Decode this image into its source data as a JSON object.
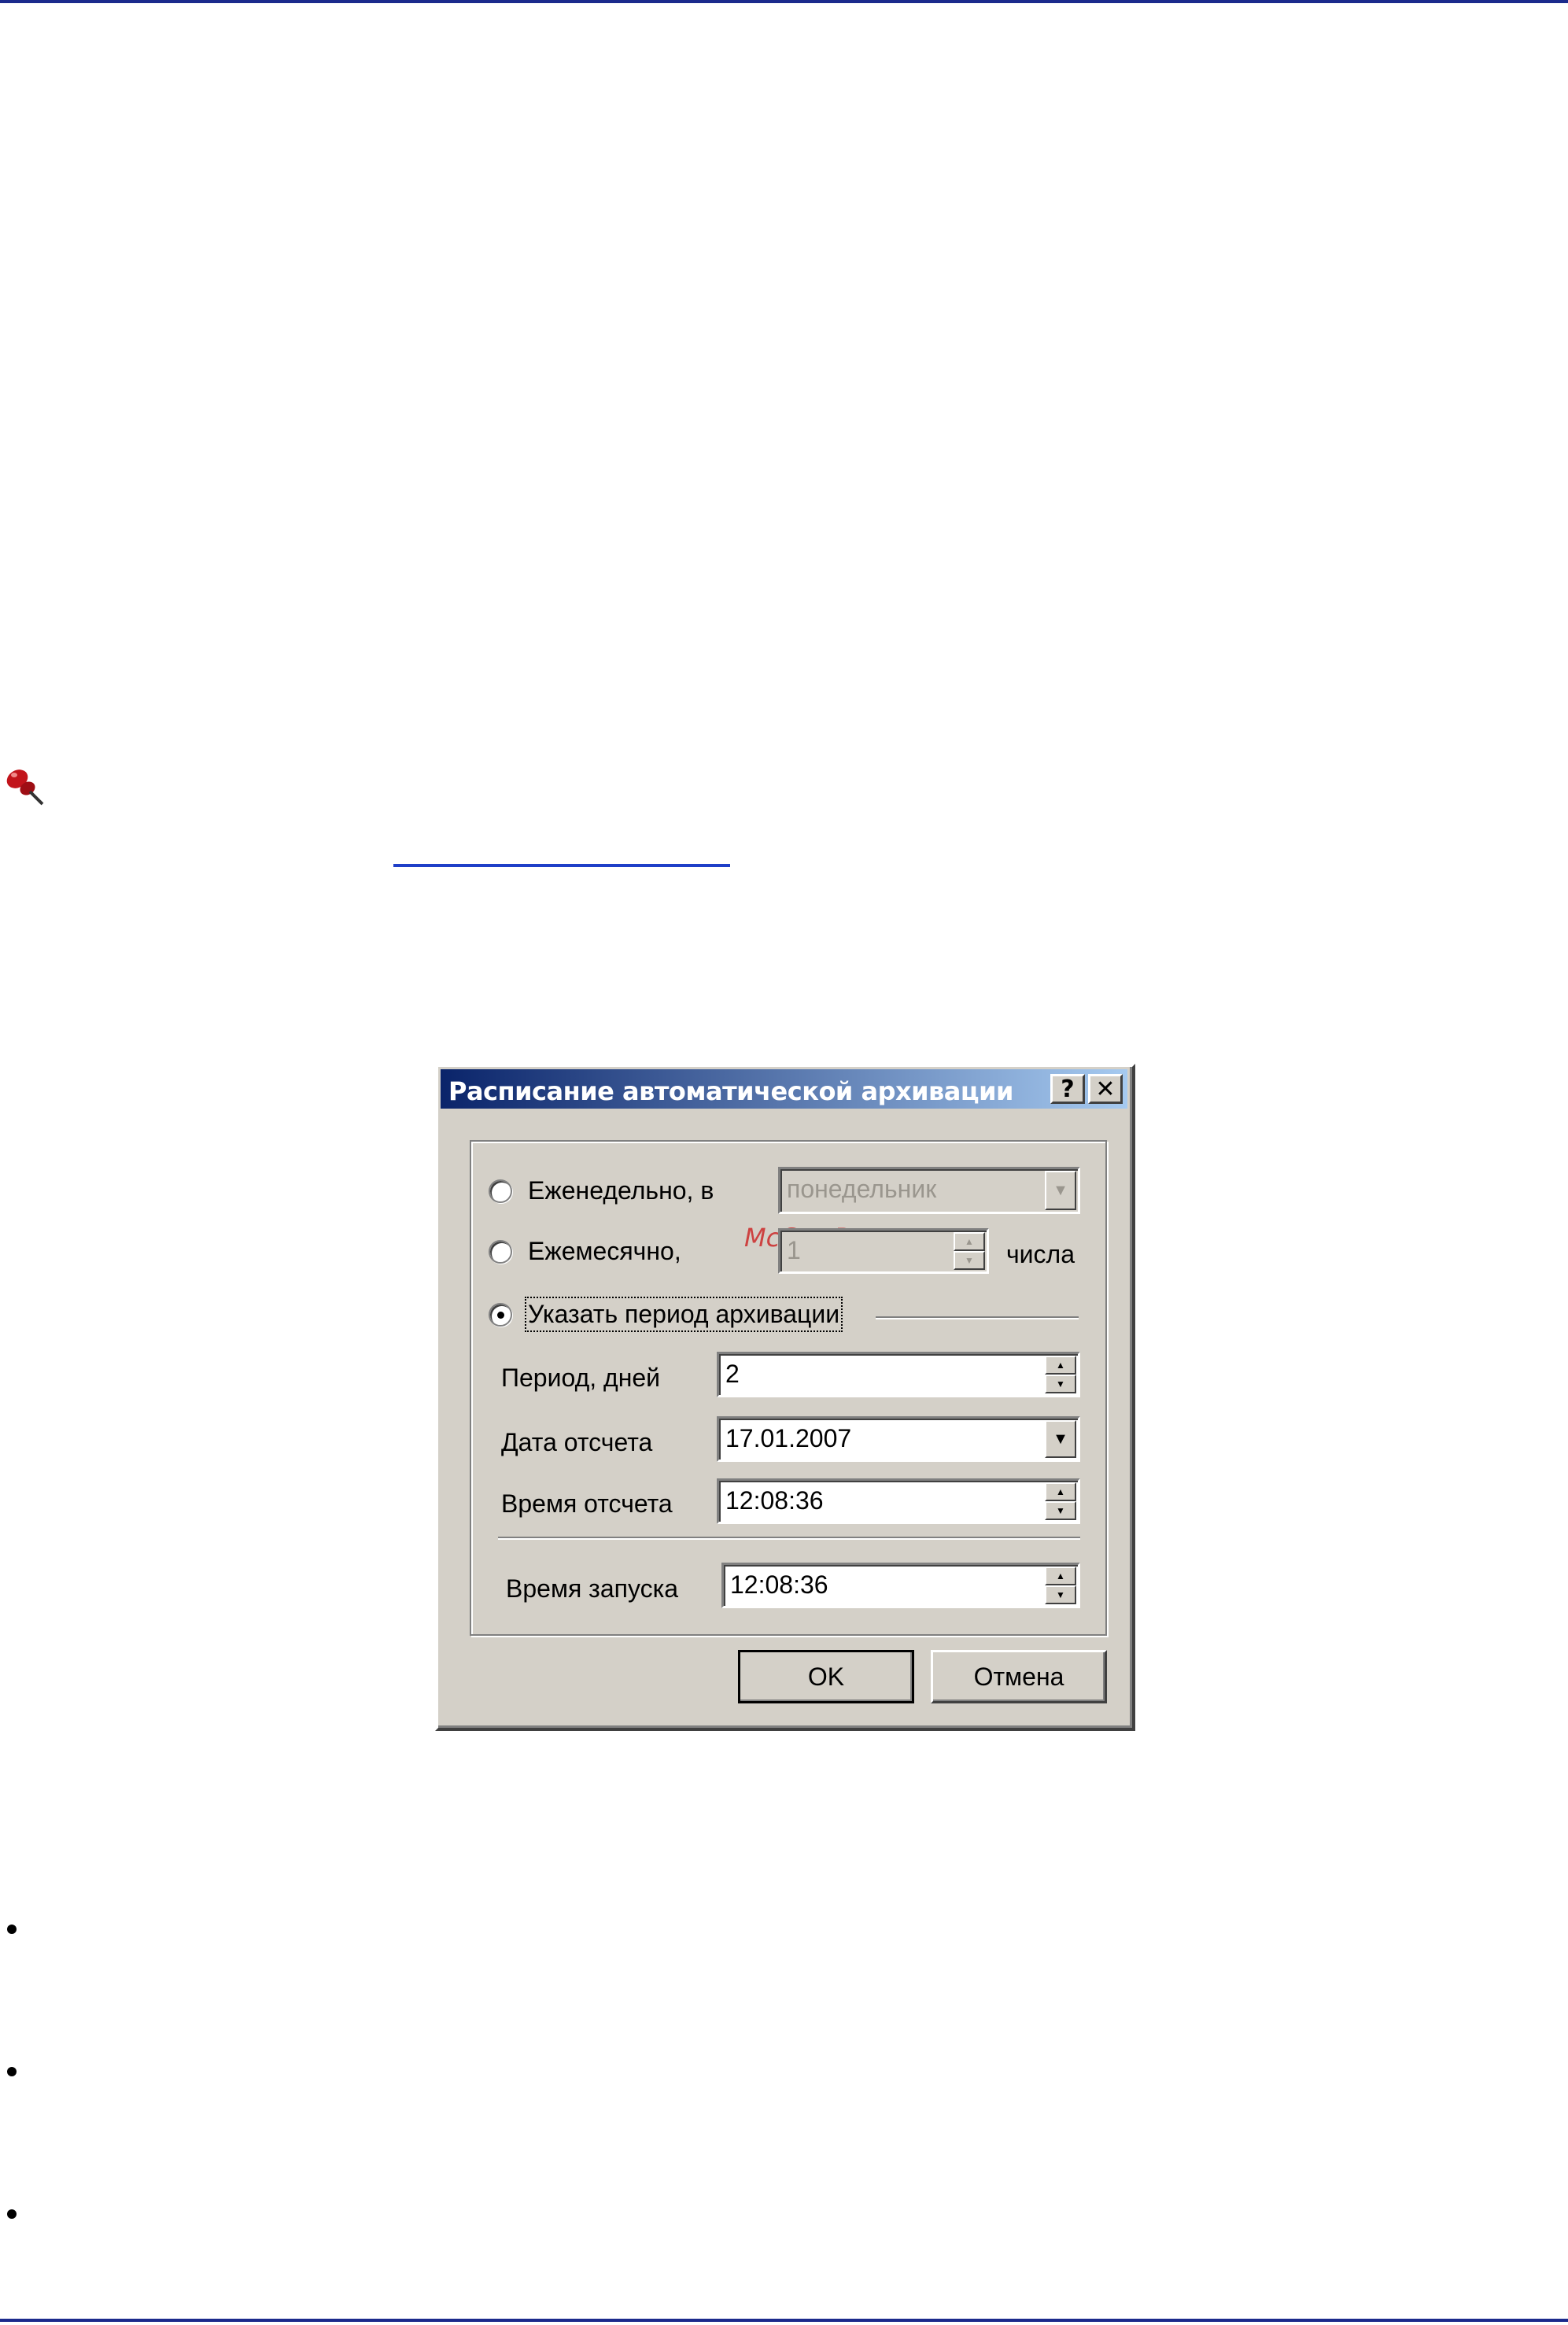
{
  "dialog": {
    "title": "Расписание автоматической архивации",
    "help_button": "?",
    "close_button": "✕",
    "watermark": "McGrp.Ru",
    "weekly": {
      "label": "Еженедельно, в",
      "value": "понедельник",
      "selected": false,
      "enabled": false
    },
    "monthly": {
      "label": "Ежемесячно,",
      "value": "1",
      "suffix": "числа",
      "selected": false,
      "enabled": false
    },
    "period_option": {
      "label": "Указать период архивации",
      "selected": true
    },
    "period_days": {
      "label": "Период, дней",
      "value": "2"
    },
    "start_date": {
      "label": "Дата отсчета",
      "value": "17.01.2007"
    },
    "start_time": {
      "label": "Время отсчета",
      "value": "12:08:36"
    },
    "launch_time": {
      "label": "Время запуска",
      "value": "12:08:36"
    },
    "ok_button": "OK",
    "cancel_button": "Отмена"
  },
  "icons": {
    "pin": "pushpin-icon",
    "arrow_up": "▲",
    "arrow_down": "▼"
  },
  "colors": {
    "title_start": "#0a246a",
    "title_end": "#a6caf0",
    "rule": "#1b2a8c",
    "link": "#1f3fc8",
    "watermark": "#cc2a2a"
  }
}
